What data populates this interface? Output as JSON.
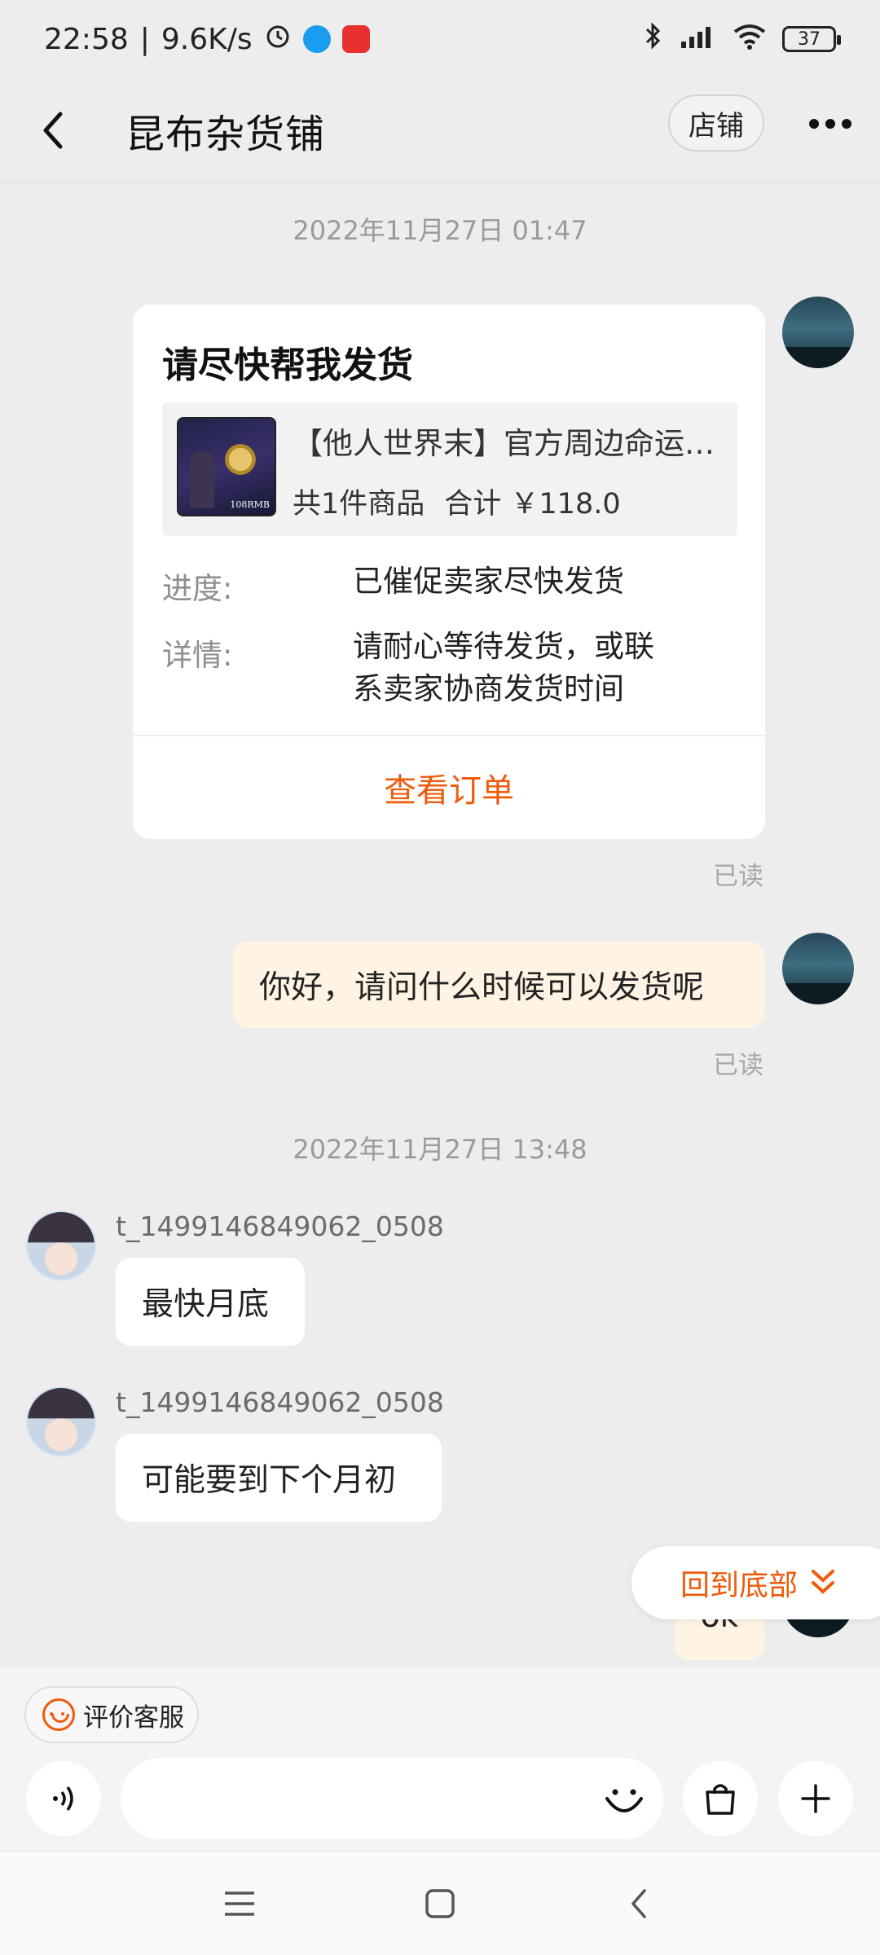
{
  "status_bar": {
    "time": "22:58",
    "speed": "9.6K/s",
    "battery": "37"
  },
  "header": {
    "title": "昆布杂货铺",
    "shop_button": "店铺"
  },
  "messages": {
    "timestamp_1": "2022年11月27日 01:47",
    "order_card": {
      "title": "请尽快帮我发货",
      "product_name": "【他人世界末】官方周边命运纪念品",
      "item_count": "共1件商品",
      "total": "合计 ￥118.0",
      "thumb_price": "108RMB",
      "progress_label": "进度:",
      "progress_value": "已催促卖家尽快发货",
      "detail_label": "详情:",
      "detail_value": "请耐心等待发货，或联系卖家协商发货时间",
      "view_order": "查看订单"
    },
    "read_1": "已读",
    "self_msg_1": "你好，请问什么时候可以发货呢",
    "read_2": "已读",
    "timestamp_2": "2022年11月27日 13:48",
    "seller_name_1": "t_1499146849062_0508",
    "seller_msg_1": "最快月底",
    "seller_name_2": "t_1499146849062_0508",
    "seller_msg_2": "可能要到下个月初",
    "self_msg_2": "ok",
    "back_to_bottom": "回到底部"
  },
  "bottom": {
    "rate_service": "评价客服"
  },
  "colors": {
    "accent": "#ef5a0b",
    "self_bubble": "#fff4e4",
    "background": "#ededed"
  }
}
